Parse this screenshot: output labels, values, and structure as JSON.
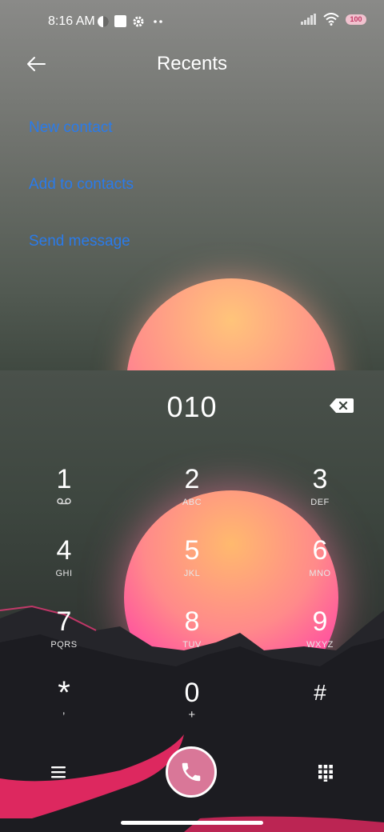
{
  "status_bar": {
    "time": "8:16 AM",
    "battery": "100"
  },
  "header": {
    "title": "Recents"
  },
  "menu": {
    "new_contact": "New contact",
    "add_to_contacts": "Add to contacts",
    "send_message": "Send message"
  },
  "dialer": {
    "number": "010",
    "keys": [
      {
        "digit": "1",
        "letters": ""
      },
      {
        "digit": "2",
        "letters": "ABC"
      },
      {
        "digit": "3",
        "letters": "DEF"
      },
      {
        "digit": "4",
        "letters": "GHI"
      },
      {
        "digit": "5",
        "letters": "JKL"
      },
      {
        "digit": "6",
        "letters": "MNO"
      },
      {
        "digit": "7",
        "letters": "PQRS"
      },
      {
        "digit": "8",
        "letters": "TUV"
      },
      {
        "digit": "9",
        "letters": "WXYZ"
      },
      {
        "digit": "*",
        "letters": ","
      },
      {
        "digit": "0",
        "letters": "+"
      },
      {
        "digit": "#",
        "letters": ""
      }
    ]
  },
  "colors": {
    "link": "#2a7bea",
    "call_button": "#d97798"
  },
  "icons": {
    "back": "arrow-left-icon",
    "backspace": "backspace-icon",
    "voicemail": "voicemail-icon",
    "menu": "hamburger-icon",
    "call": "phone-icon",
    "keypad": "keypad-icon"
  }
}
